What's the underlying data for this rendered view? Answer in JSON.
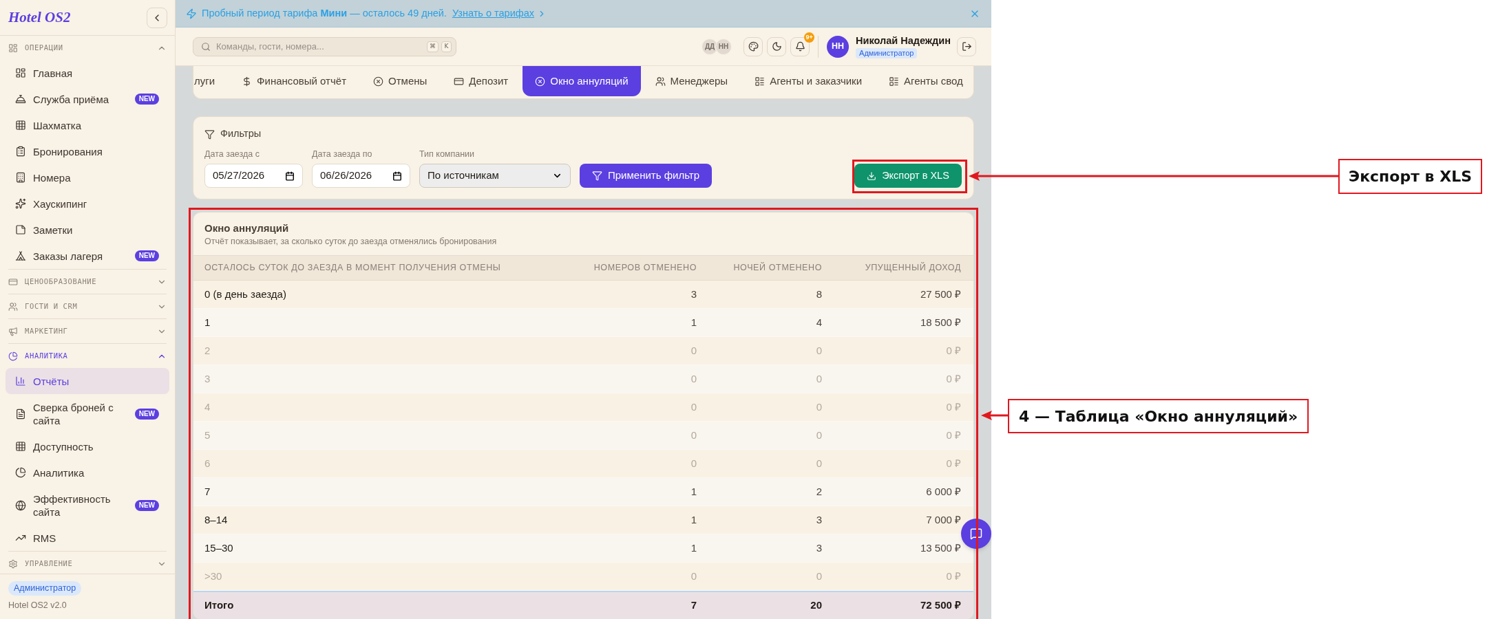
{
  "sidebar": {
    "logo": "Hotel OS2",
    "sections": [
      {
        "title": "ОПЕРАЦИИ",
        "expanded": true,
        "items": [
          {
            "label": "Главная",
            "selected": false
          },
          {
            "label": "Служба приёма",
            "badge": "NEW",
            "selected": false
          },
          {
            "label": "Шахматка",
            "selected": false
          },
          {
            "label": "Бронирования",
            "selected": false
          },
          {
            "label": "Номера",
            "selected": false
          },
          {
            "label": "Хаускипинг",
            "selected": false
          },
          {
            "label": "Заметки",
            "selected": false
          },
          {
            "label": "Заказы лагеря",
            "badge": "NEW",
            "selected": false
          }
        ]
      },
      {
        "title": "ЦЕНООБРАЗОВАНИЕ",
        "expanded": false
      },
      {
        "title": "ГОСТИ И CRM",
        "expanded": false
      },
      {
        "title": "МАРКЕТИНГ",
        "expanded": false
      },
      {
        "title": "АНАЛИТИКА",
        "expanded": true,
        "items": [
          {
            "label": "Отчёты",
            "selected": true
          },
          {
            "label": "Сверка броней с сайта",
            "badge": "NEW",
            "selected": false
          },
          {
            "label": "Доступность",
            "selected": false
          },
          {
            "label": "Аналитика",
            "selected": false
          },
          {
            "label": "Эффективность сайта",
            "badge": "NEW",
            "selected": false
          },
          {
            "label": "RMS",
            "selected": false
          }
        ]
      },
      {
        "title": "УПРАВЛЕНИЕ",
        "expanded": false
      }
    ],
    "footer": {
      "role_badge": "Администратор",
      "version": "Hotel OS2 v2.0"
    }
  },
  "banner": {
    "text": "Пробный период тарифа **Мини** — осталось 49 дней.",
    "link": "Узнать о тарифах"
  },
  "header": {
    "search": {
      "placeholder": "Команды, гости, номера...",
      "shortcut_keys": [
        "⌘",
        "K"
      ]
    },
    "online_users": [
      "ДД",
      "НН"
    ],
    "notifications_badge": "9+",
    "user": {
      "initials": "НН",
      "name": "Николай Надеждин",
      "role": "Администратор"
    }
  },
  "tabs": [
    {
      "label": "луги",
      "selected": false
    },
    {
      "label": "Финансовый отчёт",
      "selected": false
    },
    {
      "label": "Отмены",
      "selected": false
    },
    {
      "label": "Депозит",
      "selected": false
    },
    {
      "label": "Окно аннуляций",
      "selected": true
    },
    {
      "label": "Менеджеры",
      "selected": false
    },
    {
      "label": "Агенты и заказчики",
      "selected": false
    },
    {
      "label": "Агенты свод",
      "selected": false
    }
  ],
  "filters": {
    "title": "Фильтры",
    "fields": [
      {
        "kind": "date",
        "label": "Дата заезда с",
        "value": "05/27/2026"
      },
      {
        "kind": "date",
        "label": "Дата заезда по",
        "value": "06/26/2026"
      },
      {
        "kind": "select",
        "label": "Тип компании",
        "value": "По источникам"
      }
    ],
    "apply_button": "Применить фильтр",
    "export_button": "Экспорт в XLS"
  },
  "table": {
    "title": "Окно аннуляций",
    "subtitle": "Отчёт показывает, за сколько суток до заезда отменялись бронирования",
    "columns": [
      "ОСТАЛОСЬ СУТОК ДО ЗАЕЗДА В МОМЕНТ ПОЛУЧЕНИЯ ОТМЕНЫ",
      "НОМЕРОВ ОТМЕНЕНО",
      "НОЧЕЙ ОТМЕНЕНО",
      "УПУЩЕННЫЙ ДОХОД"
    ],
    "rows": [
      {
        "cells": [
          "0 (в день заезда)",
          "3",
          "8",
          "27 500 ₽"
        ],
        "muted": false
      },
      {
        "cells": [
          "1",
          "1",
          "4",
          "18 500 ₽"
        ],
        "muted": false
      },
      {
        "cells": [
          "2",
          "0",
          "0",
          "0 ₽"
        ],
        "muted": true
      },
      {
        "cells": [
          "3",
          "0",
          "0",
          "0 ₽"
        ],
        "muted": true
      },
      {
        "cells": [
          "4",
          "0",
          "0",
          "0 ₽"
        ],
        "muted": true
      },
      {
        "cells": [
          "5",
          "0",
          "0",
          "0 ₽"
        ],
        "muted": true
      },
      {
        "cells": [
          "6",
          "0",
          "0",
          "0 ₽"
        ],
        "muted": true
      },
      {
        "cells": [
          "7",
          "1",
          "2",
          "6 000 ₽"
        ],
        "muted": false
      },
      {
        "cells": [
          "8–14",
          "1",
          "3",
          "7 000 ₽"
        ],
        "muted": false
      },
      {
        "cells": [
          "15–30",
          "1",
          "3",
          "13 500 ₽"
        ],
        "muted": false
      },
      {
        "cells": [
          ">30",
          "0",
          "0",
          "0 ₽"
        ],
        "muted": true
      }
    ],
    "total": {
      "cells": [
        "Итого",
        "7",
        "20",
        "72 500 ₽"
      ]
    }
  },
  "annotations": [
    {
      "label": "Экспорт в XLS"
    },
    {
      "label": "4 — Таблица «Окно аннуляций»"
    }
  ]
}
